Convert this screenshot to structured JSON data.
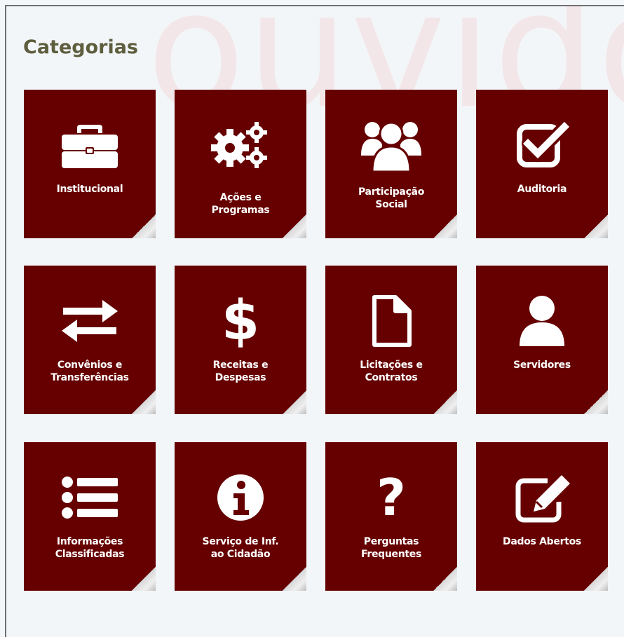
{
  "page": {
    "title": "Categorias"
  },
  "categories": [
    {
      "label": "Institucional",
      "icon": "briefcase-icon"
    },
    {
      "label": "Ações e\nProgramas",
      "icon": "gears-icon"
    },
    {
      "label": "Participação\nSocial",
      "icon": "users-icon"
    },
    {
      "label": "Auditoria",
      "icon": "checkbox-icon"
    },
    {
      "label": "Convênios e\nTransferências",
      "icon": "exchange-arrows-icon"
    },
    {
      "label": "Receitas e\nDespesas",
      "icon": "dollar-icon"
    },
    {
      "label": "Licitações e\nContratos",
      "icon": "document-icon"
    },
    {
      "label": "Servidores",
      "icon": "user-icon"
    },
    {
      "label": "Informações\nClassificadas",
      "icon": "list-icon"
    },
    {
      "label": "Serviço de Inf.\nao Cidadão",
      "icon": "info-icon"
    },
    {
      "label": "Perguntas\nFrequentes",
      "icon": "question-icon"
    },
    {
      "label": "Dados Abertos",
      "icon": "edit-icon"
    }
  ],
  "colors": {
    "tile": "#660000",
    "title": "#5e5e3f",
    "background": "#f3f6f9"
  }
}
